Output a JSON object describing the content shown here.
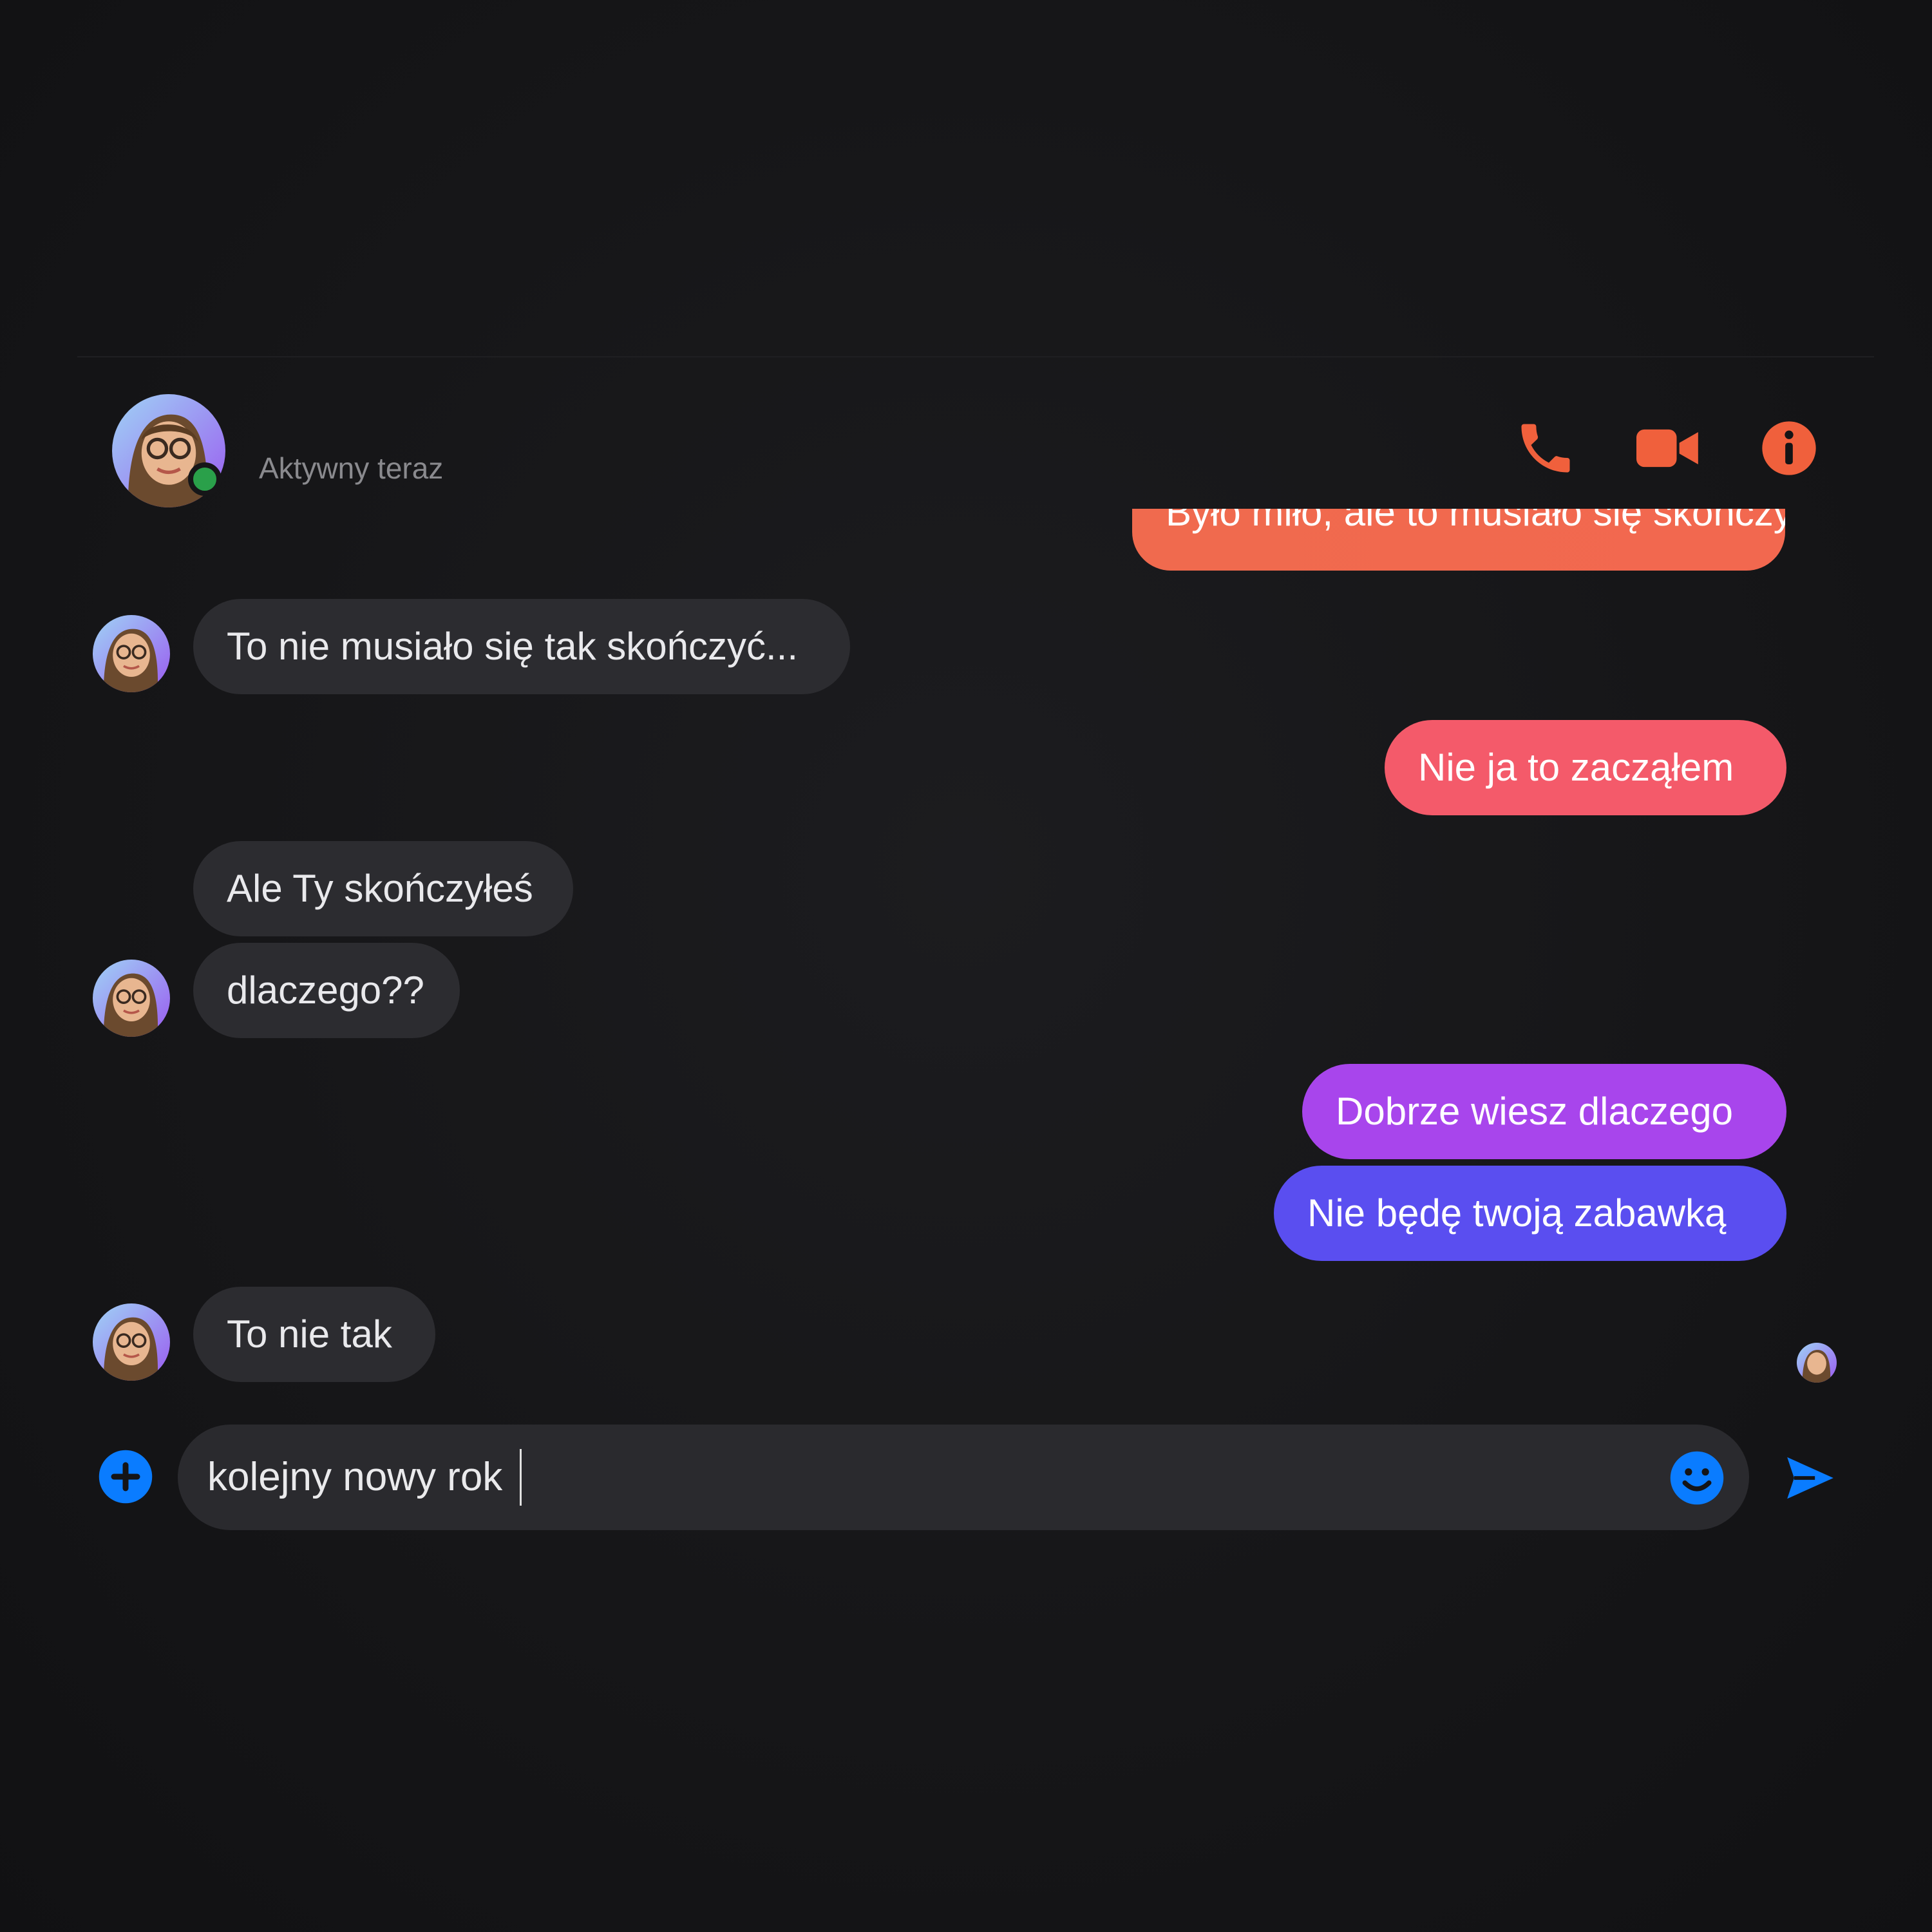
{
  "header": {
    "status": "Aktywny teraz",
    "icons": [
      "phone-icon",
      "video-camera-icon",
      "info-icon"
    ],
    "accent_color": "#f0603c"
  },
  "conversation": {
    "partial_message": "Było miło, ale to musiało się skończyć",
    "messages": [
      {
        "side": "in",
        "text": "To nie musiało się tak skończyć..."
      },
      {
        "side": "out",
        "text": "Nie ja to zacząłem",
        "color": "#f45a6a"
      },
      {
        "side": "in",
        "text": "Ale Ty skończyłeś"
      },
      {
        "side": "in",
        "text": "dlaczego??"
      },
      {
        "side": "out",
        "text": "Dobrze wiesz dlaczego",
        "color": "#a845ec"
      },
      {
        "side": "out",
        "text": "Nie będę twoją zabawką",
        "color": "#5a4ef0"
      },
      {
        "side": "in",
        "text": "To nie tak"
      }
    ]
  },
  "composer": {
    "value": "kolejny nowy rok",
    "icons": [
      "plus-circle-icon",
      "smile-icon",
      "send-icon"
    ],
    "icon_color": "#0a7cff"
  }
}
